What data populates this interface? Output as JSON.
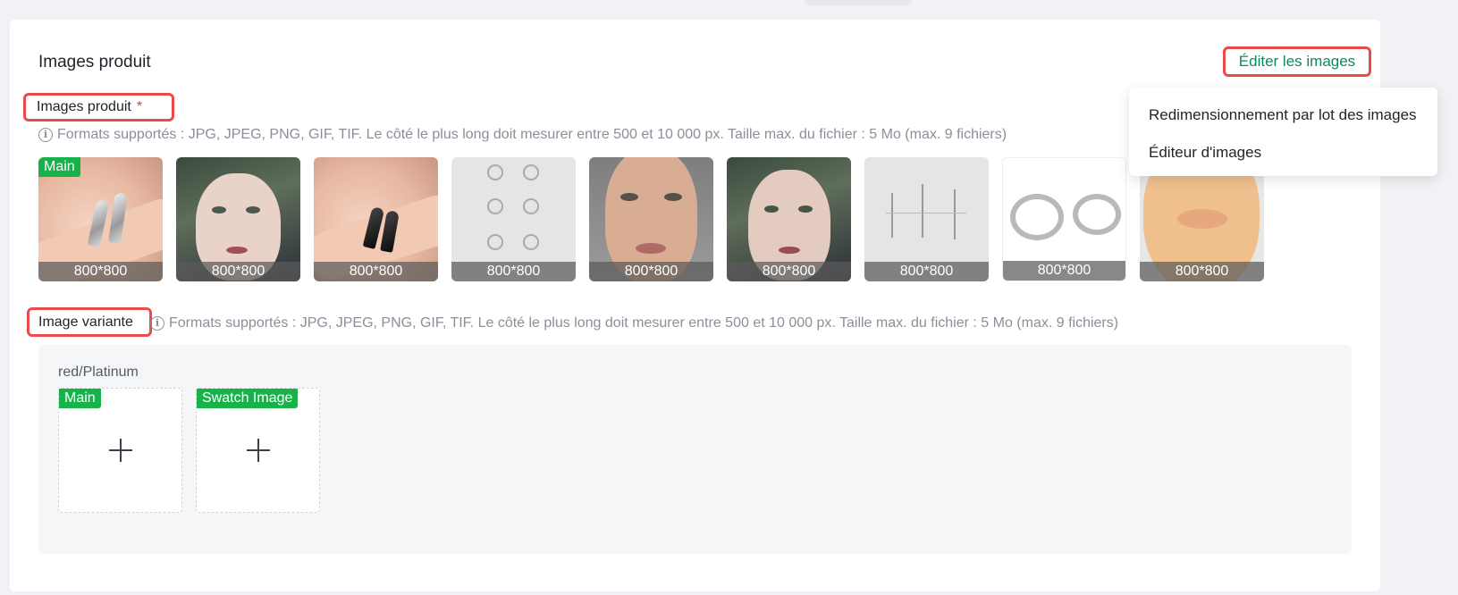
{
  "section": {
    "title": "Images produit",
    "edit_button": "Éditer les images"
  },
  "product_images": {
    "label": "Images produit",
    "required_mark": "*",
    "hint": "Formats supportés : JPG, JPEG, PNG, GIF, TIF. Le côté le plus long doit mesurer entre 500 et 10 000 px. Taille max. du fichier : 5 Mo (max. 9 fichiers)",
    "main_badge": "Main",
    "thumbnails": [
      {
        "dims": "800*800",
        "subject": "silver horn ring on finger"
      },
      {
        "dims": "800*800",
        "subject": "woman with green hair and lip piercing"
      },
      {
        "dims": "800*800",
        "subject": "black horn ring on finger"
      },
      {
        "dims": "800*800",
        "subject": "set of hoop nose rings"
      },
      {
        "dims": "800*800",
        "subject": "woman face close-up"
      },
      {
        "dims": "800*800",
        "subject": "woman with green hair"
      },
      {
        "dims": "800*800",
        "subject": "piercing dimensions diagram"
      },
      {
        "dims": "800*800",
        "subject": "hoop ring measurements"
      },
      {
        "dims": "800*800",
        "subject": "lip model with studs"
      }
    ]
  },
  "variant_images": {
    "label": "Image variante",
    "hint": "Formats supportés : JPG, JPEG, PNG, GIF, TIF. Le côté le plus long doit mesurer entre 500 et 10 000 px. Taille max. du fichier : 5 Mo (max. 9 fichiers)",
    "variant_name": "red/Platinum",
    "slots": [
      {
        "badge": "Main"
      },
      {
        "badge": "Swatch Image"
      }
    ]
  },
  "dropdown": {
    "items": [
      "Redimensionnement par lot des images",
      "Éditeur d'images"
    ]
  },
  "colors": {
    "accent_green": "#0d8a5c",
    "badge_green": "#18b24a",
    "highlight_red": "#ea4b4b"
  }
}
